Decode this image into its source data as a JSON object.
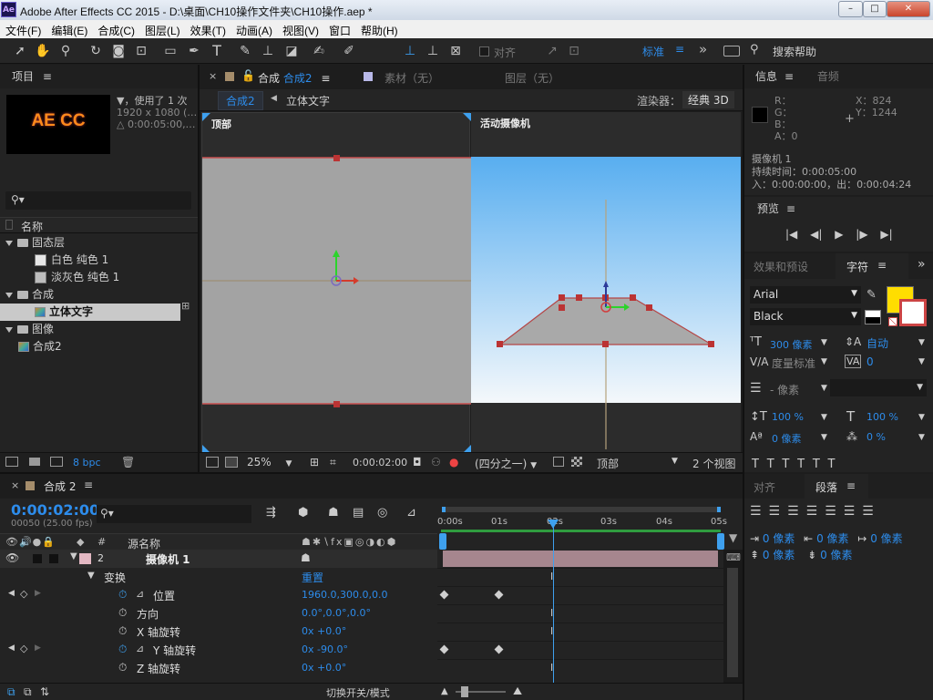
{
  "window": {
    "app_icon": "Ae",
    "title": "Adobe After Effects CC 2015 - D:\\桌面\\CH10操作文件夹\\CH10操作.aep *",
    "minimize": "–",
    "maximize": "□",
    "close": "✕"
  },
  "menu": [
    "文件(F)",
    "编辑(E)",
    "合成(C)",
    "图层(L)",
    "效果(T)",
    "动画(A)",
    "视图(V)",
    "窗口",
    "帮助(H)"
  ],
  "toolbar": {
    "snap_label": "对齐",
    "workspace": "标准",
    "more": "»",
    "search_placeholder": "搜索帮助"
  },
  "project": {
    "tab": "项目",
    "menu_icon": "≡",
    "thumb_text": "AE CC",
    "info_line1": "▼，使用了 1 次",
    "info_line2": "1920 x 1080 (…",
    "info_line3": "△ 0:00:05:00,…",
    "search_placeholder": "",
    "col_name": "名称",
    "items": [
      {
        "label": "固态层",
        "type": "folder",
        "indent": 0
      },
      {
        "label": "白色 纯色 1",
        "type": "solid",
        "indent": 1,
        "color": "#e6e6e6"
      },
      {
        "label": "淡灰色 纯色 1",
        "type": "solid",
        "indent": 1,
        "color": "#bdbdbd"
      },
      {
        "label": "合成",
        "type": "folder",
        "indent": 0
      },
      {
        "label": "立体文字",
        "type": "comp",
        "indent": 1,
        "selected": true
      },
      {
        "label": "图像",
        "type": "folder",
        "indent": 0
      },
      {
        "label": "合成2",
        "type": "comp",
        "indent": 0
      }
    ],
    "bpc": "8 bpc"
  },
  "viewer": {
    "tab_comp_prefix": "合成",
    "tab_comp": "合成2",
    "tab_footage": "素材（无）",
    "tab_layer": "图层（无）",
    "crumb1": "合成2",
    "crumb2": "立体文字",
    "renderer_label": "渲染器：",
    "renderer": "经典 3D",
    "left_view": "顶部",
    "right_view": "活动摄像机",
    "zoom": "25%",
    "timecode": "0:00:02:00",
    "resolution": "(四分之一)",
    "view": "顶部",
    "layout": "2 个视图"
  },
  "info": {
    "tab": "信息",
    "tab2": "音频",
    "r": "R：",
    "g": "G：",
    "b": "B：",
    "a": "A：0",
    "x": "X：824",
    "y": "Y：1244",
    "layer": "摄像机 1",
    "duration": "持续时间：0:00:05:00",
    "inout": "入：0:00:00:00，出：0:00:04:24"
  },
  "preview": {
    "tab": "预览"
  },
  "character": {
    "tab1": "效果和预设",
    "tab2": "字符",
    "font": "Arial",
    "style": "Black",
    "size": "300 像素",
    "leading": "自动",
    "kerning": "度量标准",
    "tracking": "0",
    "stroke": "- 像素",
    "vscale": "100 %",
    "hscale": "100 %",
    "baseline": "0 像素",
    "tsume": "0 %",
    "fill_color": "#ffdd00"
  },
  "paragraph": {
    "tab1": "对齐",
    "tab2": "段落",
    "indent_left": "0 像素",
    "indent_right": "0 像素",
    "indent_first": "0 像素",
    "space_before": "0 像素",
    "space_after": "0 像素"
  },
  "timeline": {
    "tab": "合成 2",
    "timecode": "0:00:02:00",
    "frames": "00050 (25.00 fps)",
    "col_num": "#",
    "col_source": "源名称",
    "ruler": [
      "0:00s",
      "01s",
      "02s",
      "03s",
      "04s",
      "05s"
    ],
    "layer_num": "2",
    "layer_name": "摄像机 1",
    "group": "变换",
    "reset": "重置",
    "props": [
      {
        "name": "位置",
        "value": "1960.0,300.0,0.0",
        "animated": true,
        "kfs": [
          0,
          1
        ]
      },
      {
        "name": "方向",
        "value": "0.0°,0.0°,0.0°",
        "animated": false,
        "kfs": []
      },
      {
        "name": "X 轴旋转",
        "value": "0x +0.0°",
        "animated": false,
        "kfs": []
      },
      {
        "name": "Y 轴旋转",
        "value": "0x -90.0°",
        "animated": true,
        "kfs": [
          0,
          1
        ]
      },
      {
        "name": "Z 轴旋转",
        "value": "0x +0.0°",
        "animated": false,
        "kfs": []
      }
    ],
    "bottom_mode": "切换开关/模式",
    "playhead_sec": 2,
    "duration_sec": 5
  }
}
